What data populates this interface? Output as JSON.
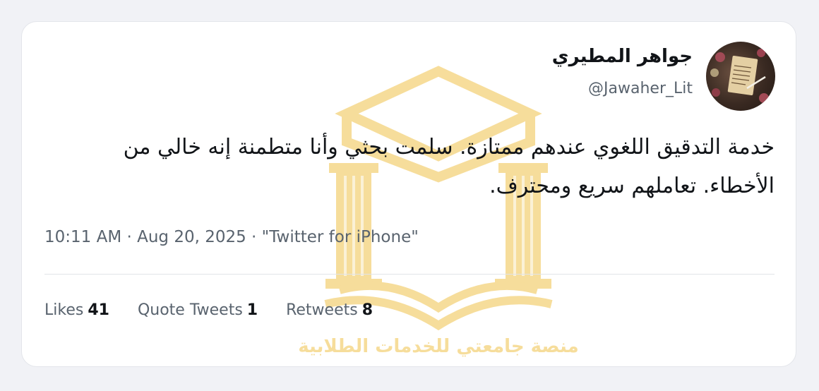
{
  "tweet": {
    "display_name": "جواهر المطيري",
    "handle": "@Jawaher_Lit",
    "text_line_1": "خدمة التدقيق اللغوي عندهم ممتازة. سلمت بحثي وأنا متطمنة إنه خالي من",
    "text_line_2": "الأخطاء. تعاملهم سريع ومحترف.",
    "meta": "10:11 AM · Aug 20, 2025 · \"Twitter for iPhone\"",
    "avatar_icon": "parchment-avatar-icon"
  },
  "stats": {
    "likes_label": "Likes",
    "likes_count": "41",
    "quotes_label": "Quote Tweets",
    "quotes_count": "1",
    "retweets_label": "Retweets",
    "retweets_count": "8"
  },
  "watermark": {
    "text": "منصة جامعتي للخدمات الطلابية",
    "color": "#f0c24a"
  },
  "colors": {
    "background": "#f1f2f6",
    "card": "#ffffff",
    "text_primary": "#111418",
    "text_secondary": "#59636e"
  }
}
